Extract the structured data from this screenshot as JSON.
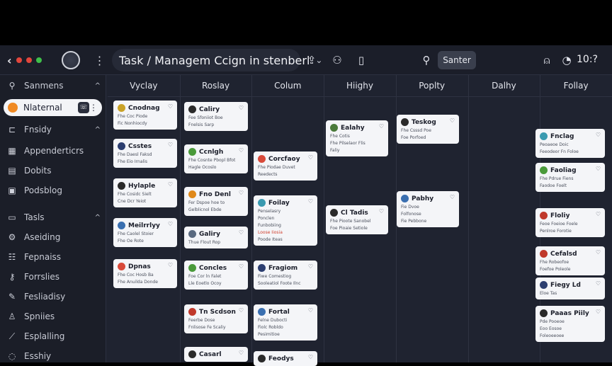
{
  "topbar": {
    "title": "Task / Managem Ccign in stenberl",
    "search_label": "Santer",
    "time": "10:?"
  },
  "sidebar": {
    "header": "Sanmens",
    "active": "Nlaternal",
    "items": [
      {
        "label": "Fnsidy",
        "icon": "inbox-icon",
        "caret": "^"
      },
      {
        "label": "Appenderticrs",
        "icon": "grid-icon"
      },
      {
        "label": "Dobits",
        "icon": "list-icon"
      },
      {
        "label": "Podsblog",
        "icon": "calendar-icon"
      },
      {
        "label": "Tasls",
        "icon": "doc-icon",
        "caret": "^"
      },
      {
        "label": "Aseiding",
        "icon": "settings-icon"
      },
      {
        "label": "Fepnaiss",
        "icon": "team-icon"
      },
      {
        "label": "Forrslies",
        "icon": "key-icon"
      },
      {
        "label": "Fesliadisy",
        "icon": "pencil-icon"
      },
      {
        "label": "Spniies",
        "icon": "user-icon"
      },
      {
        "label": "Esplalling",
        "icon": "wand-icon"
      },
      {
        "label": "Esshiy",
        "icon": "circle-icon"
      }
    ]
  },
  "columns": [
    "Vyclay",
    "Roslay",
    "Colum",
    "Hiighy",
    "Poplty",
    "Dalhy",
    "Follay"
  ],
  "cards": [
    {
      "col": 0,
      "title": "Cnodnag",
      "lines": [
        "Fhe Coc Piode",
        "Fic Nonhiocdy"
      ],
      "color": "#c9a227"
    },
    {
      "col": 0,
      "title": "Csstes",
      "lines": [
        "Fhe Daesl Faksd",
        "Fhe Eio Irnalis"
      ],
      "color": "#2c3e70"
    },
    {
      "col": 0,
      "title": "Hylaple",
      "lines": [
        "Fhe Cosidc Sielt",
        "Cne Dcr Yeiot"
      ],
      "color": "#2a2a2a"
    },
    {
      "col": 0,
      "title": "Meilrrlyy",
      "lines": [
        "Fhe Caolel Stoier",
        "Fhe Oe Rote"
      ],
      "color": "#3a6fb0"
    },
    {
      "col": 0,
      "title": "Dpnas",
      "lines": [
        "Fhe Coc Hosb Ba",
        "Fhe Anuilda Donde"
      ],
      "color": "#d84a3a"
    },
    {
      "col": 1,
      "title": "Caliry",
      "lines": [
        "Fee Sfoniiot Boe",
        "Fnelsis Sarp"
      ],
      "color": "#2a2a2a"
    },
    {
      "col": 1,
      "title": "Ccnlgh",
      "lines": [
        "Fhe Cosnte Pbopl Bfot",
        "Hagle Ocoslo"
      ],
      "color": "#4a9a3a"
    },
    {
      "col": 1,
      "title": "Fno Denl",
      "lines": [
        "Fer Dspoe hoe to",
        "Gelblicnol Ebde"
      ],
      "color": "#e0891a"
    },
    {
      "col": 1,
      "title": "Galiry",
      "lines": [
        "Thue Flout Rop"
      ],
      "color": "#5a6a80"
    },
    {
      "col": 1,
      "title": "Concles",
      "lines": [
        "Foe Cor ln Falet",
        "Lle Eoetlo Ocoy"
      ],
      "color": "#4a9a3a"
    },
    {
      "col": 1,
      "title": "Tn Scdson",
      "lines": [
        "Feerbe Dose",
        "Fnlisose Fe Scaliy"
      ],
      "color": "#c0392b"
    },
    {
      "col": 1,
      "title": "Casarl",
      "lines": [],
      "color": "#2a2a2a"
    },
    {
      "col": 2,
      "title": "Corcfaoy",
      "lines": [
        "Fhe Piodae Duvet",
        "Reedects"
      ],
      "color": "#d84a3a"
    },
    {
      "col": 2,
      "title": "Foilay",
      "lines": [
        "Penselasry",
        "Ponclen",
        "Funbobiing",
        "Loose Iiosia",
        "Poode Iteas"
      ],
      "color": "#3a9ab0",
      "red_line": 3
    },
    {
      "col": 2,
      "title": "Fragiom",
      "lines": [
        "Fiwe Comestiog",
        "Sooleatiol Foote Ilnc"
      ],
      "color": "#2c3e70"
    },
    {
      "col": 2,
      "title": "Fortal",
      "lines": [
        "Felne Dubocti",
        "Fiolc Robldo",
        "Pesimitioe"
      ],
      "color": "#3a6fb0"
    },
    {
      "col": 2,
      "title": "Feodys",
      "lines": [],
      "color": "#2a2a2a"
    },
    {
      "col": 3,
      "title": "Ealahy",
      "lines": [
        "Fhe Cotis",
        "Fhe Pilselaor Flis",
        "Faliy"
      ],
      "color": "#4a7a3a"
    },
    {
      "col": 3,
      "title": "Cl Tadis",
      "lines": [
        "Fhe Pioote Sanobel",
        "Foe Pioaie Setiole"
      ],
      "color": "#2a2a2a"
    },
    {
      "col": 4,
      "title": "Teskog",
      "lines": [
        "Fhe Csssd Poe",
        "Foe Porfoed"
      ],
      "color": "#2a2a2a"
    },
    {
      "col": 4,
      "title": "Pabhy",
      "lines": [
        "Fie Dvoe",
        "Folfonose",
        "Fie Pebbone"
      ],
      "color": "#3a6fb0"
    },
    {
      "col": 6,
      "title": "Fnclag",
      "lines": [
        "Peoaeoe Doic",
        "Feeodeor Fn Foloe"
      ],
      "color": "#3a9ab0"
    },
    {
      "col": 6,
      "title": "Faoliag",
      "lines": [
        "Fhe Pdrue Fiens",
        "Faodoe Foelt"
      ],
      "color": "#4a9a3a"
    },
    {
      "col": 6,
      "title": "Floliy",
      "lines": [
        "Feoe Foeioe Foele",
        "Penlroe Forotie"
      ],
      "color": "#c0392b"
    },
    {
      "col": 6,
      "title": "Cefalsd",
      "lines": [
        "Fhe Robeofoe",
        "Foefoe Poleole"
      ],
      "color": "#c0392b"
    },
    {
      "col": 6,
      "title": "Fiegy Ld",
      "lines": [
        "Eloe Tas"
      ],
      "color": "#2c3e70"
    },
    {
      "col": 6,
      "title": "Paaas Piily",
      "lines": [
        "Pde Pooeoe",
        "Eoo Eosoe",
        "Foleoeeoee"
      ],
      "color": "#2a2a2a"
    }
  ]
}
